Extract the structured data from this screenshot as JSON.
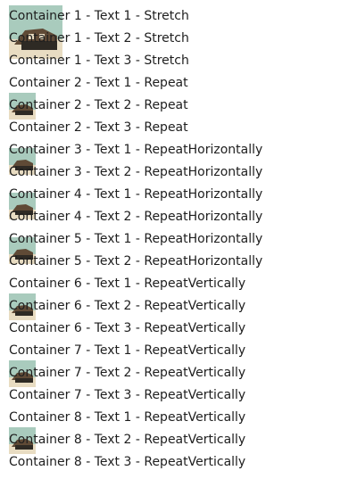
{
  "colors": {
    "text": "#1e1e1e",
    "sky": "#a9cbbd",
    "building": "#5f4a36",
    "shadow": "#2e2a24",
    "ground": "#e8dcc2"
  },
  "background_image": {
    "icon": "building-photo-icon"
  },
  "containers": [
    {
      "label": "Container 1",
      "mode": "Stretch",
      "lines": [
        "Container 1 - Text 1 - Stretch",
        "Container 1 - Text 2 - Stretch",
        "Container 1 - Text 3 - Stretch"
      ]
    },
    {
      "label": "Container 2",
      "mode": "Repeat",
      "lines": [
        "Container 2 - Text 1 - Repeat",
        "Container 2 - Text 2 - Repeat",
        "Container 2 - Text 3 - Repeat"
      ]
    },
    {
      "label": "Container 3",
      "mode": "RepeatHorizontally",
      "lines": [
        "Container 3 - Text 1 - RepeatHorizontally",
        "Container 3 - Text 2 - RepeatHorizontally"
      ]
    },
    {
      "label": "Container 4",
      "mode": "RepeatHorizontally",
      "lines": [
        "Container 4 - Text 1 - RepeatHorizontally",
        "Container 4 - Text 2 - RepeatHorizontally"
      ]
    },
    {
      "label": "Container 5",
      "mode": "RepeatHorizontally",
      "lines": [
        "Container 5 - Text 1 - RepeatHorizontally",
        "Container 5 - Text 2 - RepeatHorizontally"
      ]
    },
    {
      "label": "Container 6",
      "mode": "RepeatVertically",
      "lines": [
        "Container 6 - Text 1 - RepeatVertically",
        "Container 6 - Text 2 - RepeatVertically",
        "Container 6 - Text 3 - RepeatVertically"
      ]
    },
    {
      "label": "Container 7",
      "mode": "RepeatVertically",
      "lines": [
        "Container 7 - Text 1 - RepeatVertically",
        "Container 7 - Text 2 - RepeatVertically",
        "Container 7 - Text 3 - RepeatVertically"
      ]
    },
    {
      "label": "Container 8",
      "mode": "RepeatVertically",
      "lines": [
        "Container 8 - Text 1 - RepeatVertically",
        "Container 8 - Text 2 - RepeatVertically",
        "Container 8 - Text 3 - RepeatVertically"
      ]
    }
  ]
}
